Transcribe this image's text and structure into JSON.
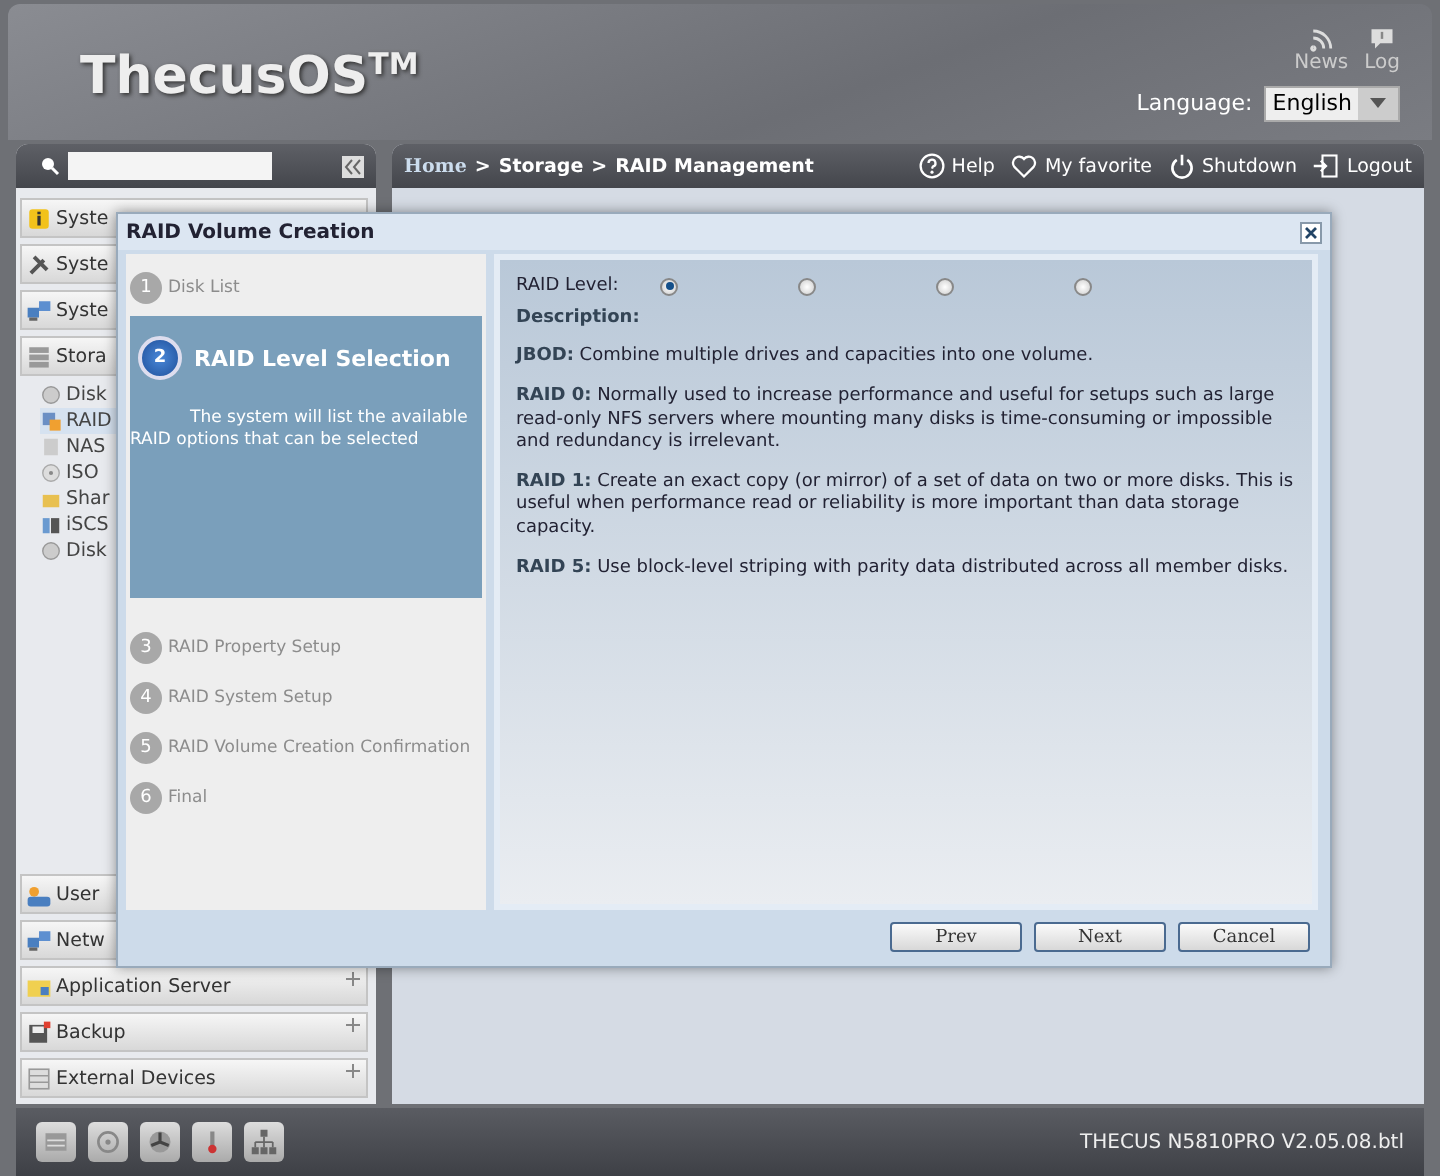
{
  "header": {
    "logo": "ThecusOS$^{TM}$",
    "links": [
      {
        "kind": "news",
        "label": "News"
      },
      {
        "kind": "log",
        "label": "Log"
      }
    ],
    "language": {
      "label": "Language:",
      "value": "English"
    }
  },
  "sidebar": {
    "groups_top": [
      {
        "kind": "info",
        "label": "Syste"
      },
      {
        "kind": "tools",
        "label": "Syste"
      },
      {
        "kind": "network",
        "label": "Syste"
      },
      {
        "kind": "storage",
        "label": "Stora",
        "children": [
          {
            "kind": "disk",
            "label": "Disk",
            "selected": false
          },
          {
            "kind": "raid",
            "label": "RAID",
            "selected": true
          },
          {
            "kind": "nas",
            "label": "NAS",
            "selected": false
          },
          {
            "kind": "iso",
            "label": "ISO",
            "selected": false
          },
          {
            "kind": "share",
            "label": "Shar",
            "selected": false
          },
          {
            "kind": "iscsi",
            "label": "iSCS",
            "selected": false
          },
          {
            "kind": "disk",
            "label": "Disk",
            "selected": false
          }
        ]
      }
    ],
    "groups_bottom": [
      {
        "kind": "users",
        "label": "User"
      },
      {
        "kind": "network",
        "label": "Netw"
      },
      {
        "kind": "app",
        "label": "Application Server",
        "expanded": false
      },
      {
        "kind": "backup",
        "label": "Backup",
        "expanded": false
      },
      {
        "kind": "external",
        "label": "External Devices",
        "expanded": false
      }
    ]
  },
  "breadcrumb": {
    "separator": ">",
    "items": [
      "Home",
      "Storage",
      "RAID Management"
    ]
  },
  "toolbar": [
    {
      "kind": "help",
      "label": "Help"
    },
    {
      "kind": "favorite",
      "label": "My favorite"
    },
    {
      "kind": "shutdown",
      "label": "Shutdown"
    },
    {
      "kind": "logout",
      "label": "Logout"
    }
  ],
  "wizard": {
    "title": "RAID Volume Creation",
    "steps": [
      {
        "number": "1",
        "label": "Disk List",
        "selected": false
      },
      {
        "number": "2",
        "label": "RAID Level Selection",
        "selected": true,
        "description": "The system will list the available RAID options that can be selected"
      },
      {
        "number": "3",
        "label": "RAID Property Setup",
        "selected": false
      },
      {
        "number": "4",
        "label": "RAID System Setup",
        "selected": false
      },
      {
        "number": "5",
        "label": "RAID Volume Creation Confirmation",
        "selected": false
      },
      {
        "number": "6",
        "label": "Final",
        "selected": false
      }
    ],
    "raid_level": {
      "label": "RAID Level:",
      "options": [
        {
          "selected": true
        },
        {
          "selected": false
        },
        {
          "selected": false
        },
        {
          "selected": false
        }
      ]
    },
    "description_title": "Description:",
    "descriptions": [
      "**JBOD:** Combine multiple drives and capacities into one volume.",
      "**RAID 0:** Normally used to increase performance and useful for setups such as large read-only NFS servers where mounting many disks is time-consuming or impossible and redundancy is irrelevant.",
      "**RAID 1:** Create an exact copy (or mirror) of a set of data on two or more disks. This is useful when performance read or reliability is more important than data storage capacity.",
      "**RAID 5:** Use block-level striping with parity data distributed across all member disks."
    ],
    "buttons": [
      "Prev",
      "Next",
      "Cancel"
    ]
  },
  "footer": {
    "icons": [
      {
        "kind": "server"
      },
      {
        "kind": "disc"
      },
      {
        "kind": "fan"
      },
      {
        "kind": "thermometer"
      },
      {
        "kind": "network"
      }
    ],
    "version": "THECUS N5810PRO V2.05.08.btl"
  }
}
